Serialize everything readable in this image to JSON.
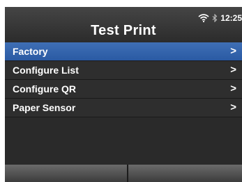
{
  "header": {
    "title": "Test Print",
    "clock": "12:25"
  },
  "status_icons": [
    "wifi-icon",
    "bluetooth-icon"
  ],
  "menu": {
    "selected_index": 0,
    "items": [
      {
        "label": "Factory",
        "chevron": ">"
      },
      {
        "label": "Configure List",
        "chevron": ">"
      },
      {
        "label": "Configure QR",
        "chevron": ">"
      },
      {
        "label": "Paper Sensor",
        "chevron": ">"
      }
    ]
  },
  "colors": {
    "selected_row": "#3366b0",
    "background": "#2a2a2a"
  }
}
